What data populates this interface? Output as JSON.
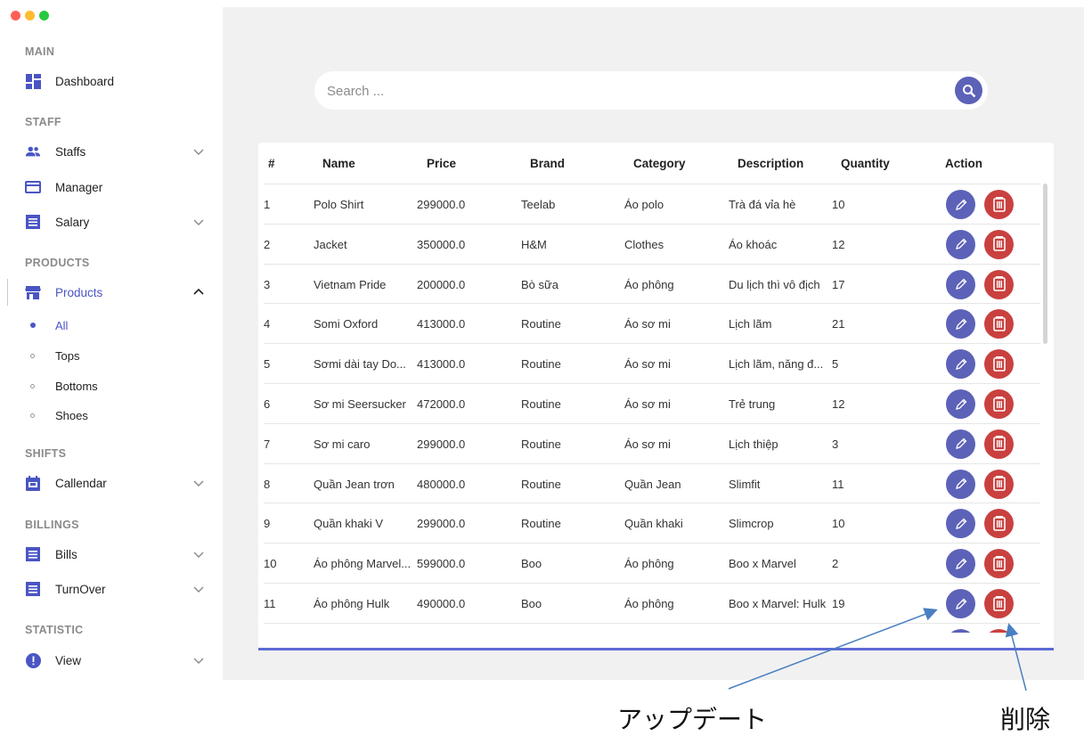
{
  "sidebar": {
    "sections": {
      "main": "MAIN",
      "staff": "STAFF",
      "products": "PRODUCTS",
      "shifts": "SHIFTS",
      "billings": "BILLINGS",
      "statistic": "STATISTIC"
    },
    "items": {
      "dashboard": "Dashboard",
      "staffs": "Staffs",
      "manager": "Manager",
      "salary": "Salary",
      "products": "Products",
      "callendar": "Callendar",
      "bills": "Bills",
      "turnover": "TurnOver",
      "view": "View"
    },
    "product_sub": [
      "All",
      "Tops",
      "Bottoms",
      "Shoes"
    ],
    "accent_color": "#4a55c4"
  },
  "search": {
    "placeholder": "Search ..."
  },
  "table": {
    "headers": [
      "#",
      "Name",
      "Price",
      "Brand",
      "Category",
      "Description",
      "Quantity",
      "Action"
    ],
    "rows": [
      [
        "1",
        "Polo Shirt",
        "299000.0",
        "Teelab",
        "Áo polo",
        "Trà đá vỉa hè",
        "10"
      ],
      [
        "2",
        "Jacket",
        "350000.0",
        "H&M",
        "Clothes",
        "Áo khoác",
        "12"
      ],
      [
        "3",
        "Vietnam Pride",
        "200000.0",
        "Bò sữa",
        "Áo phông",
        "Du lịch thì vô địch",
        "17"
      ],
      [
        "4",
        "Somi Oxford",
        "413000.0",
        "Routine",
        "Áo sơ mi",
        "Lịch lãm",
        "21"
      ],
      [
        "5",
        "Sơmi dài tay Do...",
        "413000.0",
        "Routine",
        "Áo sơ mi",
        "Lịch lãm, năng đ...",
        "5"
      ],
      [
        "6",
        "Sơ mi Seersucker",
        "472000.0",
        "Routine",
        "Áo sơ mi",
        "Trẻ trung",
        "12"
      ],
      [
        "7",
        "Sơ mi caro",
        "299000.0",
        "Routine",
        "Áo sơ mi",
        "Lịch thiệp",
        "3"
      ],
      [
        "8",
        "Quần Jean trơn",
        "480000.0",
        "Routine",
        "Quần Jean",
        "Slimfit",
        "11"
      ],
      [
        "9",
        "Quần khaki V",
        "299000.0",
        "Routine",
        "Quần khaki",
        "Slimcrop",
        "10"
      ],
      [
        "10",
        "Áo phông Marvel...",
        "599000.0",
        "Boo",
        "Áo phông",
        "Boo x Marvel",
        "2"
      ],
      [
        "11",
        "Áo phông Hulk",
        "490000.0",
        "Boo",
        "Áo phông",
        "Boo x Marvel: Hulk",
        "19"
      ]
    ],
    "edit_color": "#5c62b8",
    "delete_color": "#c9413f"
  },
  "annotations": {
    "update": "アップデート",
    "delete": "削除"
  }
}
